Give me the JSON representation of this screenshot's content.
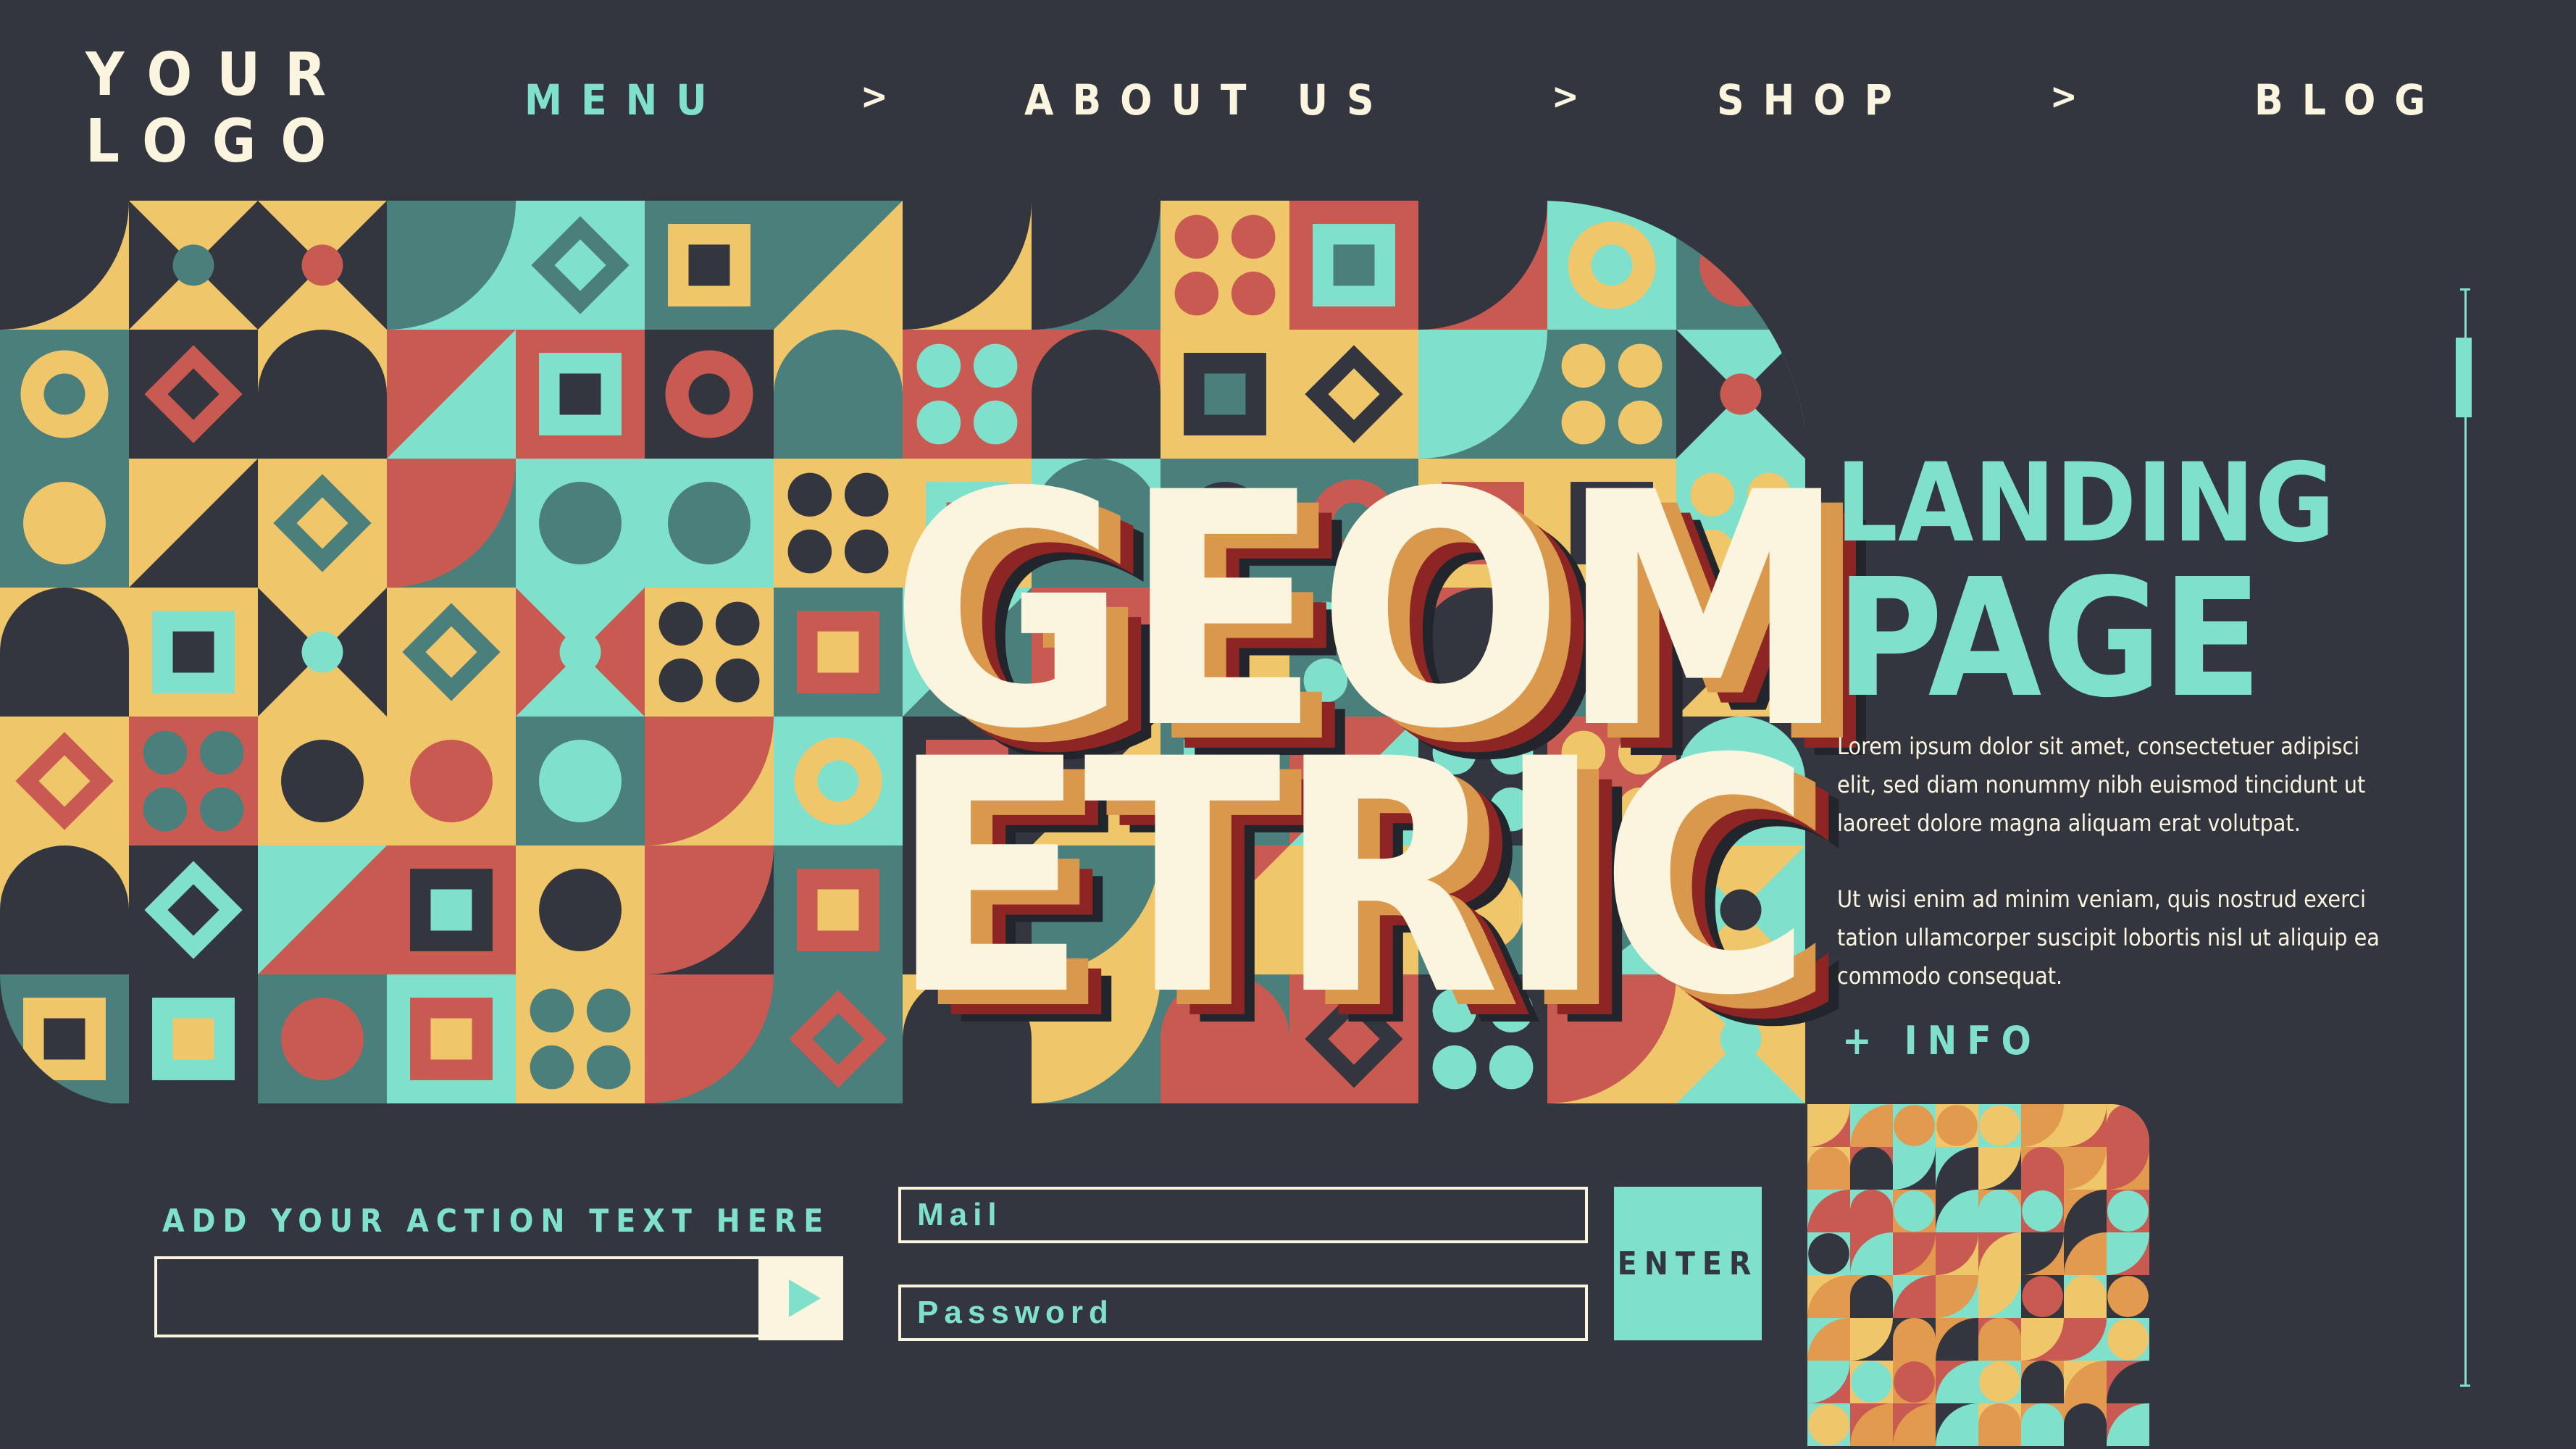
{
  "logo": {
    "text": "YOUR\nLOGO"
  },
  "nav": {
    "items": [
      {
        "label": "MENU",
        "active": true
      },
      {
        "label": "ABOUT US",
        "active": false
      },
      {
        "label": "SHOP",
        "active": false
      },
      {
        "label": "BLOG",
        "active": false
      }
    ],
    "separator": ">"
  },
  "hero": {
    "title_line1": "GEOM",
    "title_line2": "ETRIC"
  },
  "landing": {
    "title_line1": "LANDING",
    "title_line2": "PAGE",
    "paragraph1": "Lorem ipsum dolor sit amet, consectetuer adipisci elit, sed diam nonummy nibh euismod tincidunt ut laoreet dolore magna aliquam erat volutpat.",
    "paragraph2": "Ut wisi enim ad minim veniam, quis nostrud exerci tation ullamcorper suscipit lobortis nisl ut aliquip ea commodo consequat.",
    "info_link": "+ INFO"
  },
  "action": {
    "label": "ADD YOUR ACTION TEXT HERE",
    "input_value": "",
    "submit_icon": "play-icon"
  },
  "login": {
    "mail_placeholder": "Mail",
    "password_placeholder": "Password",
    "enter_label": "ENTER"
  },
  "colors": {
    "background": "#33363e",
    "cream": "#fbf4de",
    "mint": "#7fe0cc",
    "teal": "#4a7f7c",
    "coral": "#c85a52",
    "mustard": "#f0c66a",
    "orange": "#e29a4e",
    "dark": "#33363e"
  }
}
